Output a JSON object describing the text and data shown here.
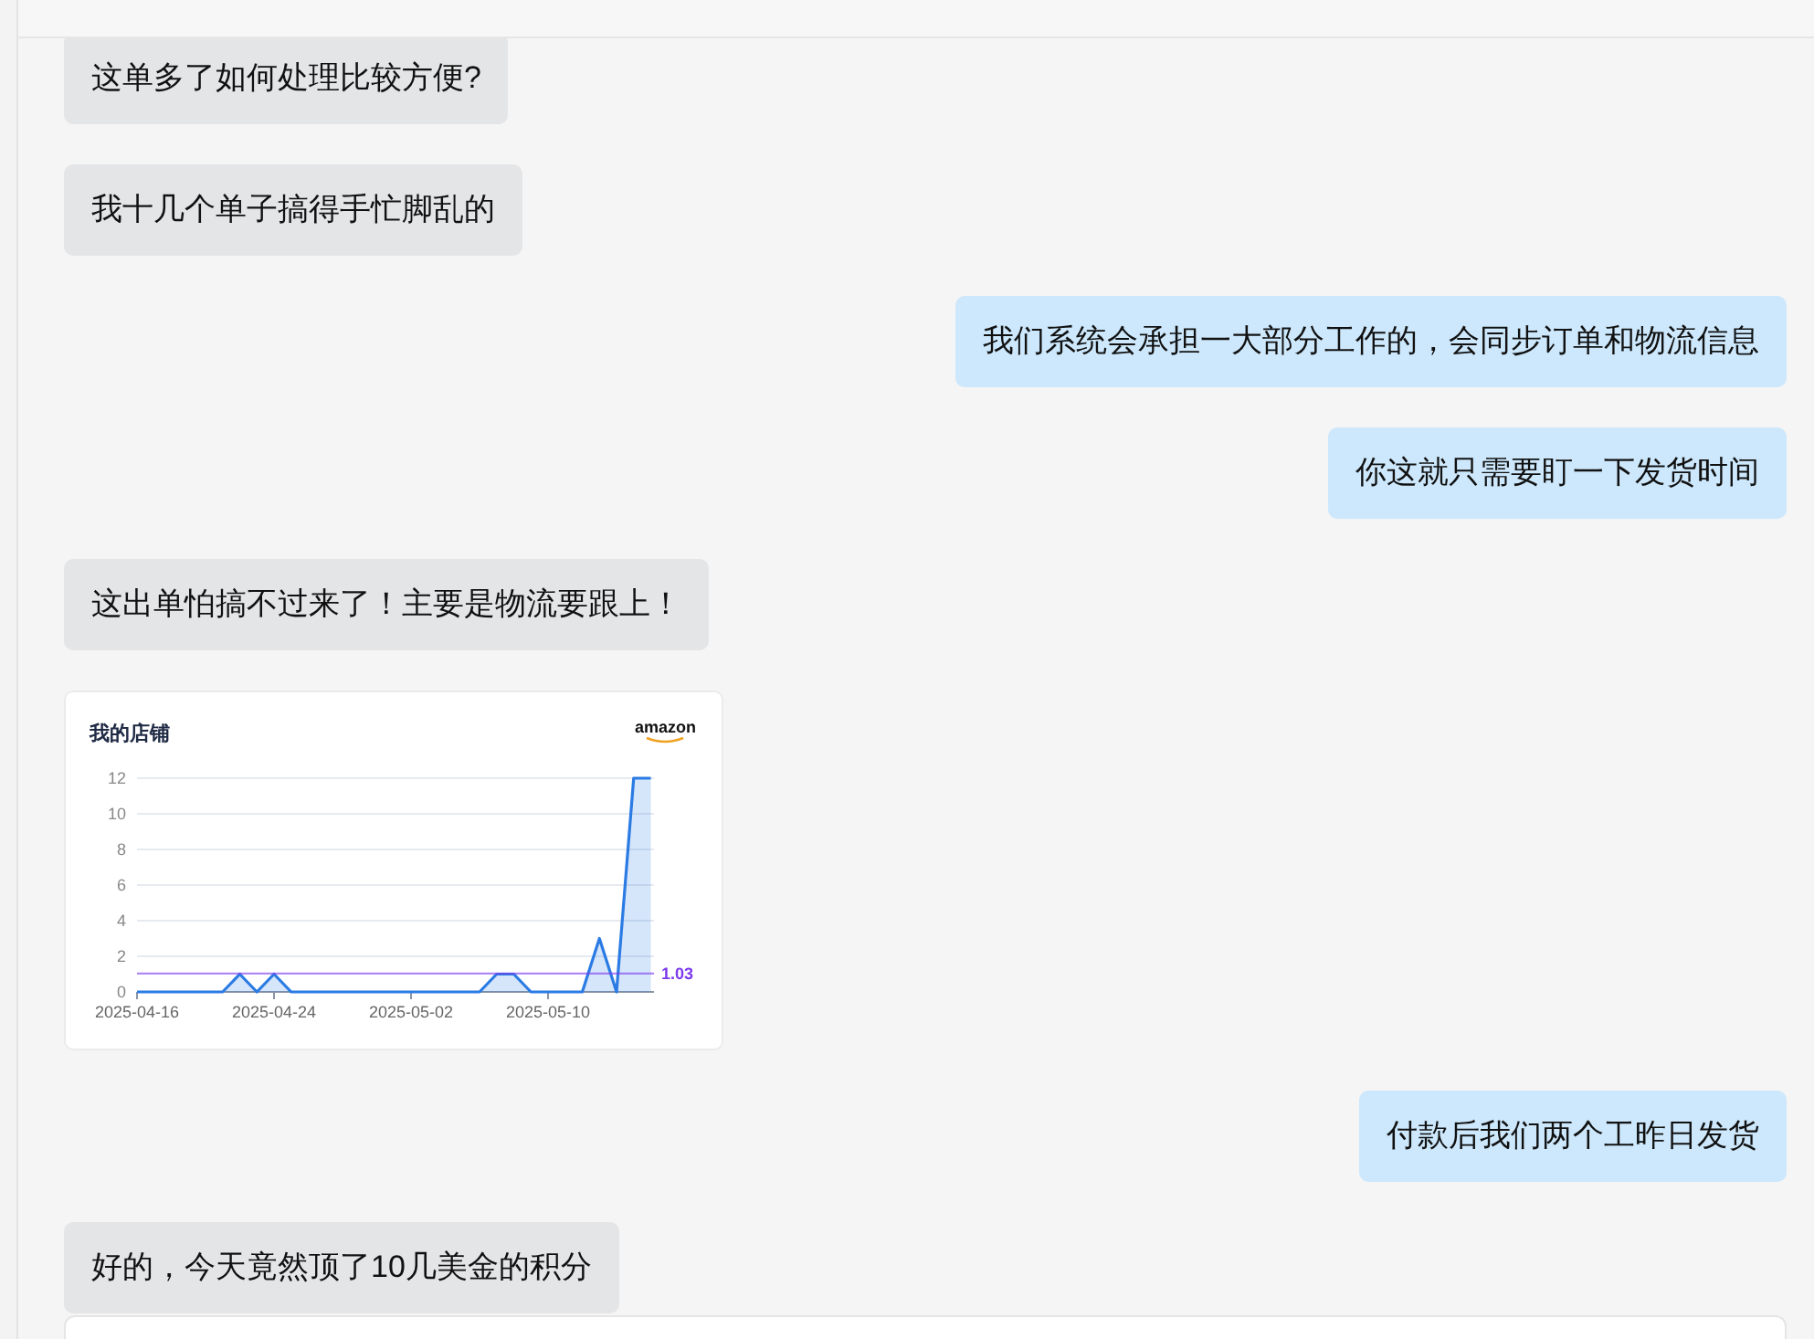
{
  "messages": [
    {
      "kind": "text",
      "outgoing": false,
      "text": "这单多了如何处理比较方便?"
    },
    {
      "kind": "text",
      "outgoing": false,
      "text": "我十几个单子搞得手忙脚乱的"
    },
    {
      "kind": "text",
      "outgoing": true,
      "text": "我们系统会承担一大部分工作的，会同步订单和物流信息"
    },
    {
      "kind": "text",
      "outgoing": true,
      "text": "你这就只需要盯一下发货时间"
    },
    {
      "kind": "text",
      "outgoing": false,
      "text": "这出单怕搞不过来了！主要是物流要跟上！"
    },
    {
      "kind": "chart",
      "outgoing": false,
      "title": "我的店铺",
      "brand": "amazon",
      "chart_data": {
        "type": "area",
        "grid": true,
        "categories": [
          "2025-04-16",
          null,
          null,
          null,
          null,
          null,
          null,
          null,
          "2025-04-24",
          null,
          null,
          null,
          null,
          null,
          null,
          null,
          "2025-05-02",
          null,
          null,
          null,
          null,
          null,
          null,
          null,
          "2025-05-10",
          null,
          null,
          null,
          null,
          null,
          null
        ],
        "series": [
          {
            "color": "#2b7be4",
            "values": [
              0,
              0,
              0,
              0,
              0,
              0,
              1,
              0,
              1,
              0,
              0,
              0,
              0,
              0,
              0,
              0,
              0,
              0,
              0,
              0,
              0,
              1,
              1,
              0,
              0,
              0,
              0,
              3,
              0,
              12,
              12
            ]
          }
        ],
        "ylim": [
          0,
          12
        ],
        "yticks": [
          0,
          2,
          4,
          6,
          8,
          10,
          12
        ],
        "ref_lines": [
          {
            "axis": "y",
            "value": 1.03,
            "label": "1.03",
            "color": "#7c3aed"
          }
        ]
      }
    },
    {
      "kind": "text",
      "outgoing": true,
      "text": "付款后我们两个工昨日发货"
    },
    {
      "kind": "text",
      "outgoing": false,
      "text": "好的，今天竟然顶了10几美金的积分"
    }
  ]
}
